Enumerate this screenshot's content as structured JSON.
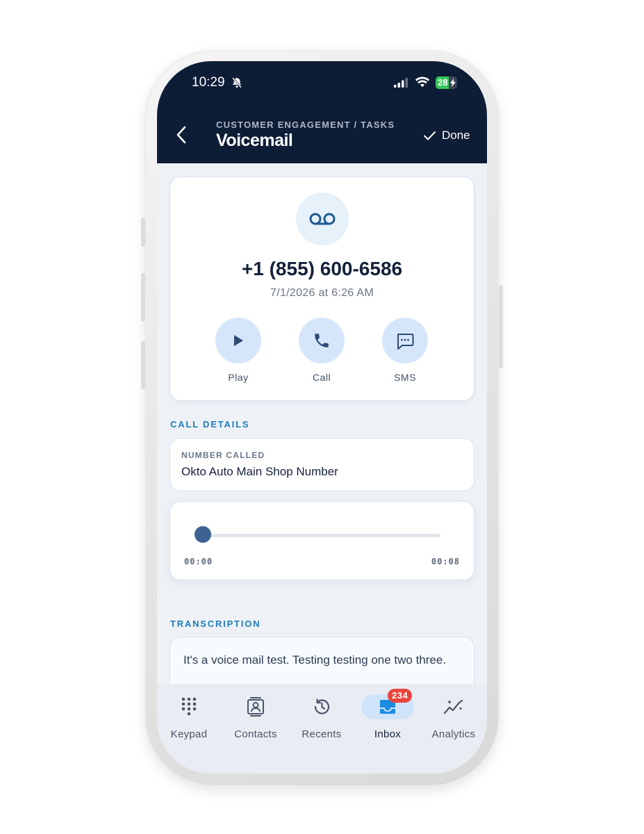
{
  "status_bar": {
    "time": "10:29",
    "battery": "28"
  },
  "header": {
    "breadcrumb": "CUSTOMER ENGAGEMENT / TASKS",
    "title": "Voicemail",
    "done_label": "Done"
  },
  "voicemail": {
    "phone_number": "+1 (855) 600-6586",
    "date": "7/1/2026 at 6:26 AM",
    "actions": {
      "play": "Play",
      "call": "Call",
      "sms": "SMS"
    }
  },
  "call_details": {
    "section_title": "CALL DETAILS",
    "number_called_label": "NUMBER CALLED",
    "number_called_value": "Okto Auto Main Shop Number"
  },
  "player": {
    "current_time": "00:00",
    "duration": "00:08",
    "progress": 0
  },
  "transcription": {
    "section_title": "TRANSCRIPTION",
    "text": "It's a voice mail test. Testing testing one two three."
  },
  "nav": {
    "keypad": "Keypad",
    "contacts": "Contacts",
    "recents": "Recents",
    "inbox": "Inbox",
    "inbox_badge": "234",
    "analytics": "Analytics",
    "active": "inbox"
  },
  "colors": {
    "header_bg": "#0e1d36",
    "accent": "#1f7bb8",
    "badge": "#e8453c",
    "action_bg": "#d6e6fa"
  }
}
